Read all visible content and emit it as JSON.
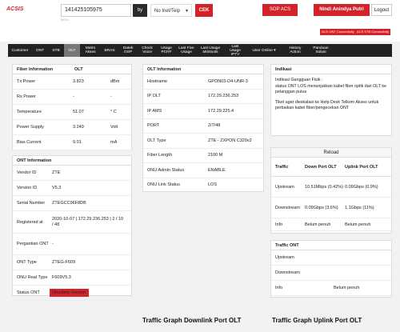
{
  "header": {
    "logo": "ACSIS",
    "search_value": "141425105975",
    "sub_line": "MOLI",
    "by_label": "by",
    "type_select": "No Inet/Telp",
    "cek_label": "CEK",
    "sop_label": "SOP ACS",
    "user_name": "Nindi Anindya Putri",
    "logout_label": "Logout",
    "badges": [
      "ACS ONT Connectivity",
      "ACS STB Connectivity"
    ]
  },
  "nav": [
    {
      "label": "Customer",
      "active": false
    },
    {
      "label": "ONT",
      "active": false
    },
    {
      "label": "STB",
      "active": false
    },
    {
      "label": "OLT",
      "active": true
    },
    {
      "label": "Metro Akses",
      "active": false
    },
    {
      "label": "BRAS",
      "active": false
    },
    {
      "label": "Datek OSP",
      "active": false
    },
    {
      "label": "Check Voice",
      "active": false
    },
    {
      "label": "Usage PCRF",
      "active": false
    },
    {
      "label": "Last Five Usage",
      "active": false
    },
    {
      "label": "Last Usage Minitools",
      "active": false
    },
    {
      "label": "Last Usage IPTV",
      "active": false
    },
    {
      "label": "User Online ▾",
      "active": false
    },
    {
      "label": "History Action",
      "active": false
    },
    {
      "label": "Panduan Solusi",
      "active": false
    }
  ],
  "fiber": {
    "title": "Fiber Information",
    "col2": "OLT",
    "rows": [
      {
        "k": "Tx Power",
        "v": "3.823",
        "u": "dBm"
      },
      {
        "k": "Rx Power",
        "v": "-",
        "u": "-"
      },
      {
        "k": "Temperature",
        "v": "51.07",
        "u": "° C"
      },
      {
        "k": "Power Supply",
        "v": "3.249",
        "u": "Volt"
      },
      {
        "k": "Bias Current",
        "v": "9.01",
        "u": "mA"
      }
    ]
  },
  "ont": {
    "title": "ONT Information",
    "rows": [
      {
        "k": "Vendor ID",
        "v": "ZTE"
      },
      {
        "k": "Version ID",
        "v": "V5.3"
      },
      {
        "k": "Serial Number",
        "v": "ZTEGCC96F8DB"
      },
      {
        "k": "Registered at",
        "v": "2020-10-07 | 172.29.236.253 | 2 / 10 / 48"
      },
      {
        "k": "Pergantian ONT",
        "v": "-"
      },
      {
        "k": "ONT Type",
        "v": "ZTEG-F609"
      },
      {
        "k": "ONU Real Type",
        "v": "F609V5.3"
      },
      {
        "k": "Status ONT",
        "v": "Obsolete Version"
      }
    ]
  },
  "olt": {
    "title": "OLT Information",
    "rows": [
      {
        "k": "Hostname",
        "v": "GPON03-D4-UNR-3"
      },
      {
        "k": "IP OLT",
        "v": "172.29.236.253"
      },
      {
        "k": "IP AMS",
        "v": "172.29.225.4"
      },
      {
        "k": "PORT",
        "v": "2/7/48"
      },
      {
        "k": "OLT Type",
        "v": "ZTE - ZXPON C320v2"
      },
      {
        "k": "Fiber Length",
        "v": "2100 M"
      },
      {
        "k": "ONU Admin Status",
        "v": "ENABLE"
      },
      {
        "k": "ONU Link Status",
        "v": "LOS"
      }
    ]
  },
  "indikasi": {
    "title": "Indikasi",
    "lines": [
      "Indikasi Gangguan Fisik :",
      "status ONT LOS menunjukkan kabel fiber optik dari OLT ke pelanggan putus",
      "Tiket agar dieskalasi ke Help Desk Telkom Akses untuk perbaikan kabel fiber/pengecekan ONT"
    ]
  },
  "traffic": {
    "reload_label": "Reload",
    "header": [
      "Traffic",
      "Down Port OLT",
      "Uplink Port OLT"
    ],
    "rows": [
      {
        "c1": "Upstream",
        "c2": "10.51Mbps (0.42%)",
        "c3": "0.09Gbps (0.9%)"
      },
      {
        "c1": "Downstream",
        "c2": "0.09Gbps (3.6%)",
        "c3": "1.1Gbps (11%)"
      },
      {
        "c1": "Info",
        "c2": "Belum penuh",
        "c3": "Belum penuh"
      }
    ]
  },
  "traffic_ont": {
    "title": "Traffic ONT",
    "rows": [
      {
        "c1": "Upstream",
        "c2": ""
      },
      {
        "c1": "Downstream",
        "c2": ""
      },
      {
        "c1": "Info",
        "c2": "Belum penuh"
      }
    ]
  },
  "graphs": {
    "downlink": "Traffic Graph Downlink Port OLT",
    "uplink": "Traffic Graph Uplink Port OLT"
  }
}
